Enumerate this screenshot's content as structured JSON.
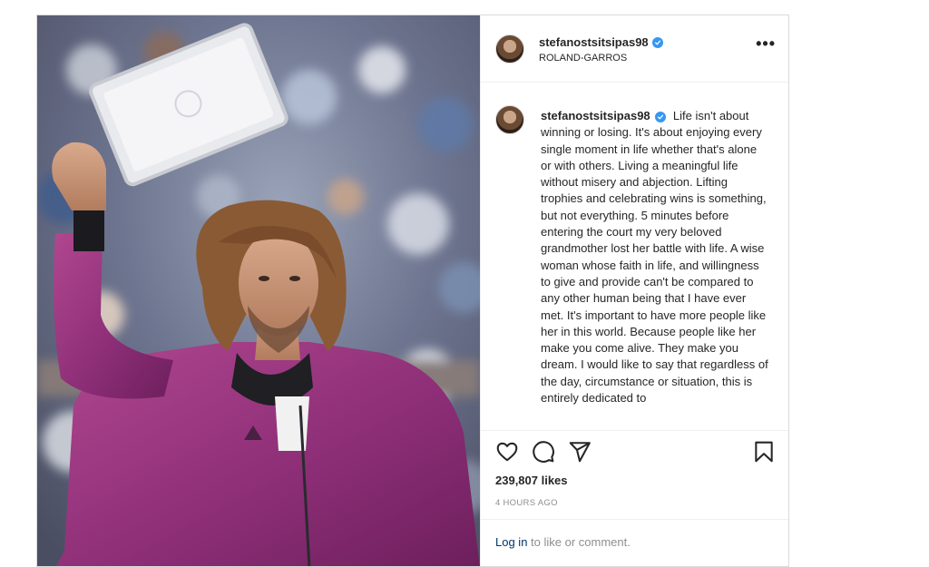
{
  "post": {
    "username": "stefanostsitsipas98",
    "location": "ROLAND-GARROS",
    "caption": "Life isn't about winning or losing. It's about enjoying every single moment in life whether that's alone or with others. Living a meaningful life without misery and abjection. Lifting trophies and celebrating wins is something, but not everything. 5 minutes before entering the court my very beloved grandmother lost her battle with life. A wise woman whose faith in life, and willingness to give and provide can't be compared to any other human being that I have ever met. It's important to have more people like her in this world. Because people like her make you come alive. They make you dream. I would like to say that regardless of the day, circumstance or situation, this is entirely dedicated to",
    "likes": "239,807 likes",
    "time_ago": "4 HOURS AGO",
    "login_link": "Log in",
    "login_rest": " to like or comment.",
    "more_icon": "•••"
  },
  "icons": {
    "verified": "verified-badge-icon",
    "like": "heart-icon",
    "comment": "comment-bubble-icon",
    "share": "paper-plane-icon",
    "save": "bookmark-icon",
    "more": "more-options-icon"
  },
  "colors": {
    "accent_blue": "#3897f0",
    "link": "#00376b",
    "secondary_text": "#8e8e8e",
    "border": "#dbdbdb",
    "jacket": "#9b3a82"
  }
}
